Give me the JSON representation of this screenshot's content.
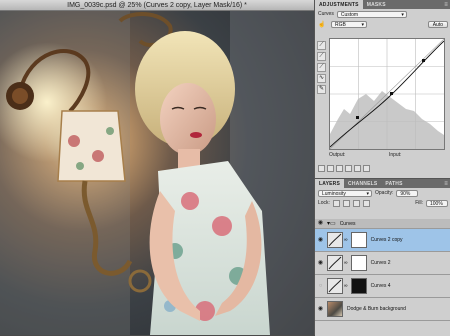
{
  "document": {
    "title": "IMG_0039c.psd @ 25% (Curves 2 copy, Layer Mask/16) *"
  },
  "adjustments_panel": {
    "tabs": [
      "ADJUSTMENTS",
      "MASKS"
    ],
    "active_tab": "ADJUSTMENTS",
    "panel_title": "Curves",
    "preset": "Custom",
    "channel": "RGB",
    "auto_label": "Auto",
    "output_label": "Output:",
    "input_label": "Input:"
  },
  "layers_panel": {
    "tabs": [
      "LAYERS",
      "CHANNELS",
      "PATHS"
    ],
    "active_tab": "LAYERS",
    "blend_mode": "Luminosity",
    "opacity_label": "Opacity:",
    "opacity_value": "90%",
    "lock_label": "Lock:",
    "fill_label": "Fill:",
    "fill_value": "100%",
    "layers": [
      {
        "name": "Curves",
        "kind": "group",
        "visible": true,
        "selected": false
      },
      {
        "name": "Curves 2 copy",
        "kind": "adjustment",
        "visible": true,
        "selected": true
      },
      {
        "name": "Curves 2",
        "kind": "adjustment",
        "visible": true,
        "selected": false
      },
      {
        "name": "Curves 4",
        "kind": "adjustment",
        "visible": false,
        "selected": false
      },
      {
        "name": "Dodge & Burn background",
        "kind": "pixel",
        "visible": true,
        "selected": false
      }
    ]
  },
  "icons": {
    "visibility": "eye-icon",
    "folder": "folder-icon",
    "link": "chain-link-icon",
    "menu": "panel-menu-icon"
  },
  "colors": {
    "selection": "#9ec4e8",
    "panel_bg": "#cfcfcf"
  }
}
